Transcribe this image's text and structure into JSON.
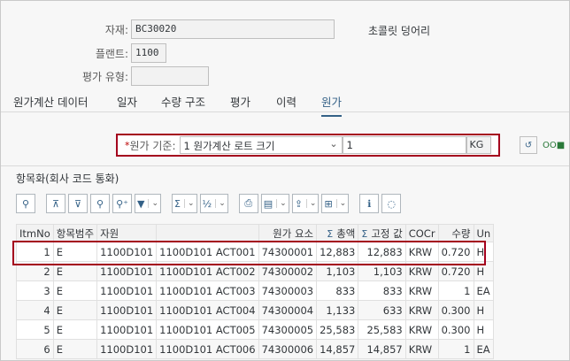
{
  "header": {
    "material_label": "자재:",
    "material_value": "BC30020",
    "material_desc": "초콜릿 덩어리",
    "plant_label": "플랜트:",
    "plant_value": "1100",
    "valtype_label": "평가 유형:",
    "valtype_value": ""
  },
  "tabs": [
    {
      "label": "원가계산 데이터"
    },
    {
      "label": "일자"
    },
    {
      "label": "수량 구조"
    },
    {
      "label": "평가"
    },
    {
      "label": "이력"
    },
    {
      "label": "원가"
    }
  ],
  "param": {
    "required_mark": "*",
    "label": "원가 기준:",
    "select_value": "1 원가계산 로트 크기",
    "qty_value": "1",
    "unit_value": "KG",
    "icon_oo": "OO"
  },
  "section": {
    "title": "항목화(회사 코드 통화)"
  },
  "toolbar": {
    "buttons": [
      {
        "name": "zoom-icon",
        "glyph": "🔍"
      },
      {
        "name": "align-top-icon",
        "glyph": "⇞"
      },
      {
        "name": "align-bottom-icon",
        "glyph": "⇟"
      },
      {
        "name": "find-icon",
        "glyph": "🔍"
      },
      {
        "name": "find-next-icon",
        "glyph": "🔍⁺"
      },
      {
        "name": "filter-icon",
        "glyph": "⏷"
      },
      {
        "name": "sum-icon",
        "glyph": "Σ"
      },
      {
        "name": "subtotal-icon",
        "glyph": "½"
      },
      {
        "name": "print-icon",
        "glyph": "⎙"
      },
      {
        "name": "views-icon",
        "glyph": "▤"
      },
      {
        "name": "export-icon",
        "glyph": "⇪"
      },
      {
        "name": "layout-icon",
        "glyph": "⊞"
      },
      {
        "name": "info-icon",
        "glyph": "ℹ"
      },
      {
        "name": "graphic-icon",
        "glyph": "◌"
      }
    ]
  },
  "grid": {
    "columns": [
      {
        "label": "ItmNo",
        "align": "l"
      },
      {
        "label": "항목범주",
        "align": "l"
      },
      {
        "label": "자원",
        "align": "l"
      },
      {
        "label": "",
        "align": "l"
      },
      {
        "label": "원가 요소",
        "align": "r"
      },
      {
        "label": "총액",
        "align": "r",
        "sigma": "Σ"
      },
      {
        "label": "고정 값",
        "align": "r",
        "sigma": "Σ"
      },
      {
        "label": "COCr",
        "align": "l"
      },
      {
        "label": "수량",
        "align": "r"
      },
      {
        "label": "Un",
        "align": "l"
      }
    ],
    "rows": [
      [
        "1",
        "E",
        "1100D101",
        "1100D101 ACT001",
        "74300001",
        "12,883",
        "12,883",
        "KRW",
        "0.720",
        "H"
      ],
      [
        "2",
        "E",
        "1100D101",
        "1100D101 ACT002",
        "74300002",
        "1,103",
        "1,103",
        "KRW",
        "0.720",
        "H"
      ],
      [
        "3",
        "E",
        "1100D101",
        "1100D101 ACT003",
        "74300003",
        "833",
        "833",
        "KRW",
        "1",
        "EA"
      ],
      [
        "4",
        "E",
        "1100D101",
        "1100D101 ACT004",
        "74300004",
        "1,133",
        "633",
        "KRW",
        "0.300",
        "H"
      ],
      [
        "5",
        "E",
        "1100D101",
        "1100D101 ACT005",
        "74300005",
        "25,583",
        "25,583",
        "KRW",
        "0.300",
        "H"
      ],
      [
        "6",
        "E",
        "1100D101",
        "1100D101 ACT006",
        "74300006",
        "14,857",
        "14,857",
        "KRW",
        "1",
        "EA"
      ]
    ]
  }
}
